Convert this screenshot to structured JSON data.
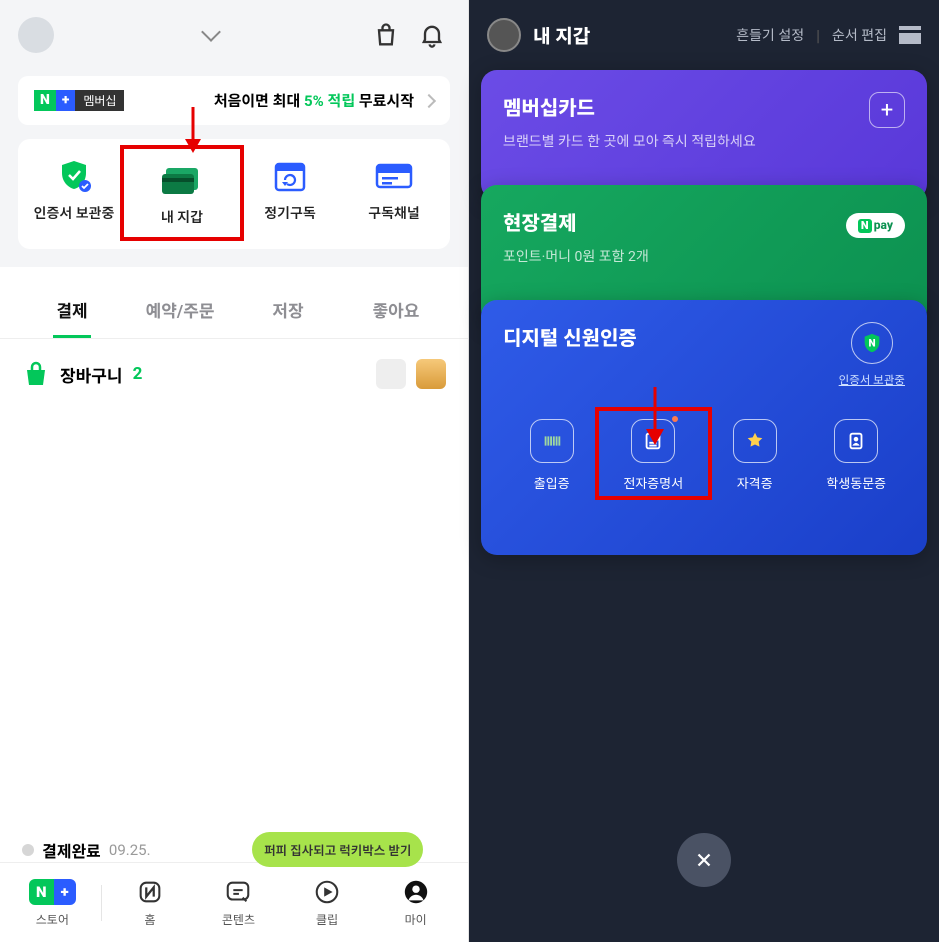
{
  "left": {
    "banner": {
      "badge_n": "N",
      "badge_plus": "+",
      "badge_member": "멤버십",
      "text_prefix": "처음이면 최대 ",
      "text_pct": "5% 적립",
      "text_suffix": " 무료시작"
    },
    "quick_actions": [
      {
        "label": "인증서 보관중"
      },
      {
        "label": "내 지갑"
      },
      {
        "label": "정기구독"
      },
      {
        "label": "구독채널"
      }
    ],
    "tabs": [
      {
        "label": "결제"
      },
      {
        "label": "예약/주문"
      },
      {
        "label": "저장"
      },
      {
        "label": "좋아요"
      }
    ],
    "cart": {
      "label": "장바구니",
      "count": "2"
    },
    "order_complete": {
      "label": "결제완료",
      "date": "09.25."
    },
    "bubble": "퍼피 집사되고 럭키박스 받기",
    "nav": [
      {
        "label": "스토어"
      },
      {
        "label": "홈"
      },
      {
        "label": "콘텐츠"
      },
      {
        "label": "클립"
      },
      {
        "label": "마이"
      }
    ]
  },
  "right": {
    "title": "내 지갑",
    "shake_setting": "흔들기 설정",
    "order_edit": "순서 편집",
    "cards": {
      "membership": {
        "title": "멤버십카드",
        "subtitle": "브랜드별 카드 한 곳에 모아 즉시 적립하세요"
      },
      "payment": {
        "title": "현장결제",
        "subtitle": "포인트·머니 0원 포함 2개",
        "npay": "pay"
      },
      "id": {
        "title": "디지털 신원인증",
        "shield_label": "인증서 보관중",
        "items": [
          {
            "label": "출입증"
          },
          {
            "label": "전자증명서"
          },
          {
            "label": "자격증"
          },
          {
            "label": "학생동문증"
          }
        ]
      }
    }
  }
}
